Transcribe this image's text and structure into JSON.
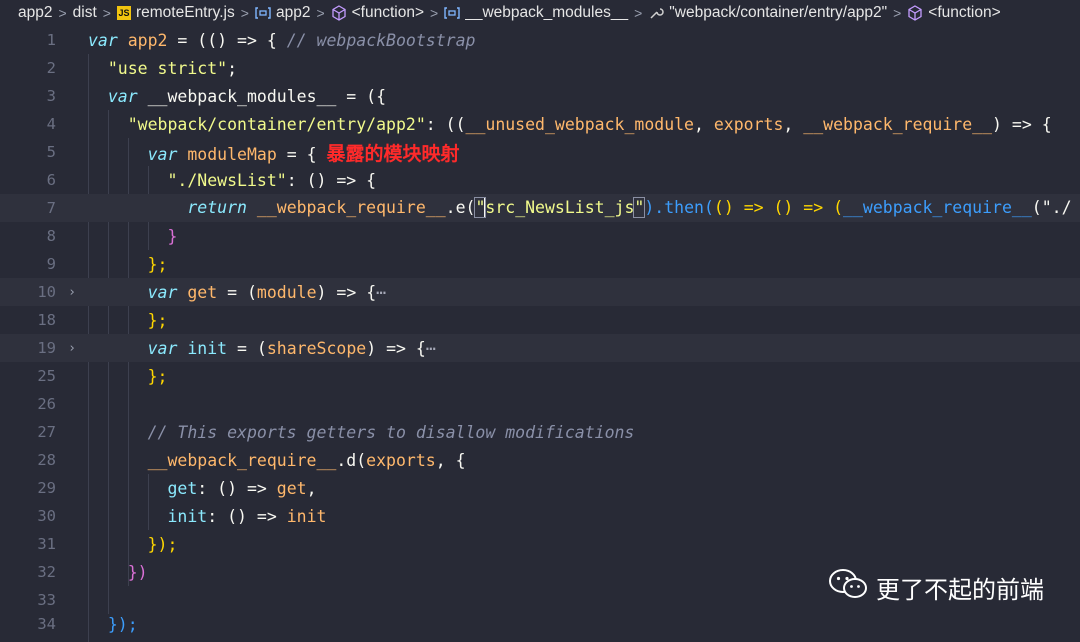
{
  "breadcrumb": [
    {
      "label": "app2",
      "icon": "none"
    },
    {
      "label": "dist",
      "icon": "none"
    },
    {
      "label": "remoteEntry.js",
      "icon": "js-file-icon"
    },
    {
      "label": "app2",
      "icon": "variable-icon"
    },
    {
      "label": "<function>",
      "icon": "cube-icon"
    },
    {
      "label": "__webpack_modules__",
      "icon": "variable-icon"
    },
    {
      "label": "\"webpack/container/entry/app2\"",
      "icon": "wrench-icon"
    },
    {
      "label": "<function>",
      "icon": "cube-icon"
    }
  ],
  "line_numbers": [
    "1",
    "2",
    "3",
    "4",
    "5",
    "6",
    "7",
    "8",
    "9",
    "10",
    "18",
    "19",
    "25",
    "26",
    "27",
    "28",
    "29",
    "30",
    "31",
    "32",
    "33",
    "34"
  ],
  "code": {
    "l1": {
      "kw": "var",
      "name": "app2",
      "rest": " = (() => { ",
      "comment": "// webpackBootstrap"
    },
    "l2": {
      "str": "\"use strict\"",
      "semi": ";"
    },
    "l3": {
      "kw": "var",
      "name": "__webpack_modules__",
      "rest": " = ({"
    },
    "l4": {
      "str": "\"webpack/container/entry/app2\"",
      "p1": ": ((",
      "a1": "__unused_webpack_module",
      "c1": ", ",
      "a2": "exports",
      "c2": ", ",
      "a3": "__webpack_require__",
      "p2": ") => {"
    },
    "l5": {
      "kw": "var",
      "name": "moduleMap",
      "rest": " = { ",
      "annotation": "暴露的模块映射"
    },
    "l6": {
      "str": "\"./NewsList\"",
      "rest": ": () => {"
    },
    "l7": {
      "kw": "return",
      "fn": "__webpack_require__",
      "dot": ".e(",
      "q1": "\"",
      "str": "src_NewsList_js",
      "q2": "\"",
      "rest1": ").then(",
      "rest2": "() => () => (",
      "fn2": "__webpack_require__",
      "rest3": "(\"./"
    },
    "l8": {
      "text": "}"
    },
    "l9": {
      "text": "};"
    },
    "l10": {
      "kw": "var",
      "name": "get",
      "rest": " = (",
      "param": "module",
      "rest2": ") => {",
      "ellipsis": "⋯"
    },
    "l18": {
      "text": "};"
    },
    "l19": {
      "kw": "var",
      "name": "init",
      "rest": " = (",
      "param": "shareScope",
      "rest2": ") => {",
      "ellipsis": "⋯"
    },
    "l25": {
      "text": "};"
    },
    "l27": {
      "comment": "// This exports getters to disallow modifications"
    },
    "l28": {
      "fn": "__webpack_require__",
      "rest": ".d(",
      "arg": "exports",
      "rest2": ", {"
    },
    "l29": {
      "key": "get",
      "rest": ": () => ",
      "val": "get",
      "comma": ","
    },
    "l30": {
      "key": "init",
      "rest": ": () => ",
      "val": "init"
    },
    "l31": {
      "text": "});"
    },
    "l32": {
      "text": "})"
    },
    "l34": {
      "text": "});"
    }
  },
  "watermark": {
    "text": "更了不起的前端",
    "icon": "wechat-icon"
  },
  "colors": {
    "background": "#282a36",
    "keyword": "#8be9fd",
    "string": "#f1fa8c",
    "comment": "#8a90a8",
    "variable": "#ffb86c",
    "annotation": "#ff2a2a"
  }
}
